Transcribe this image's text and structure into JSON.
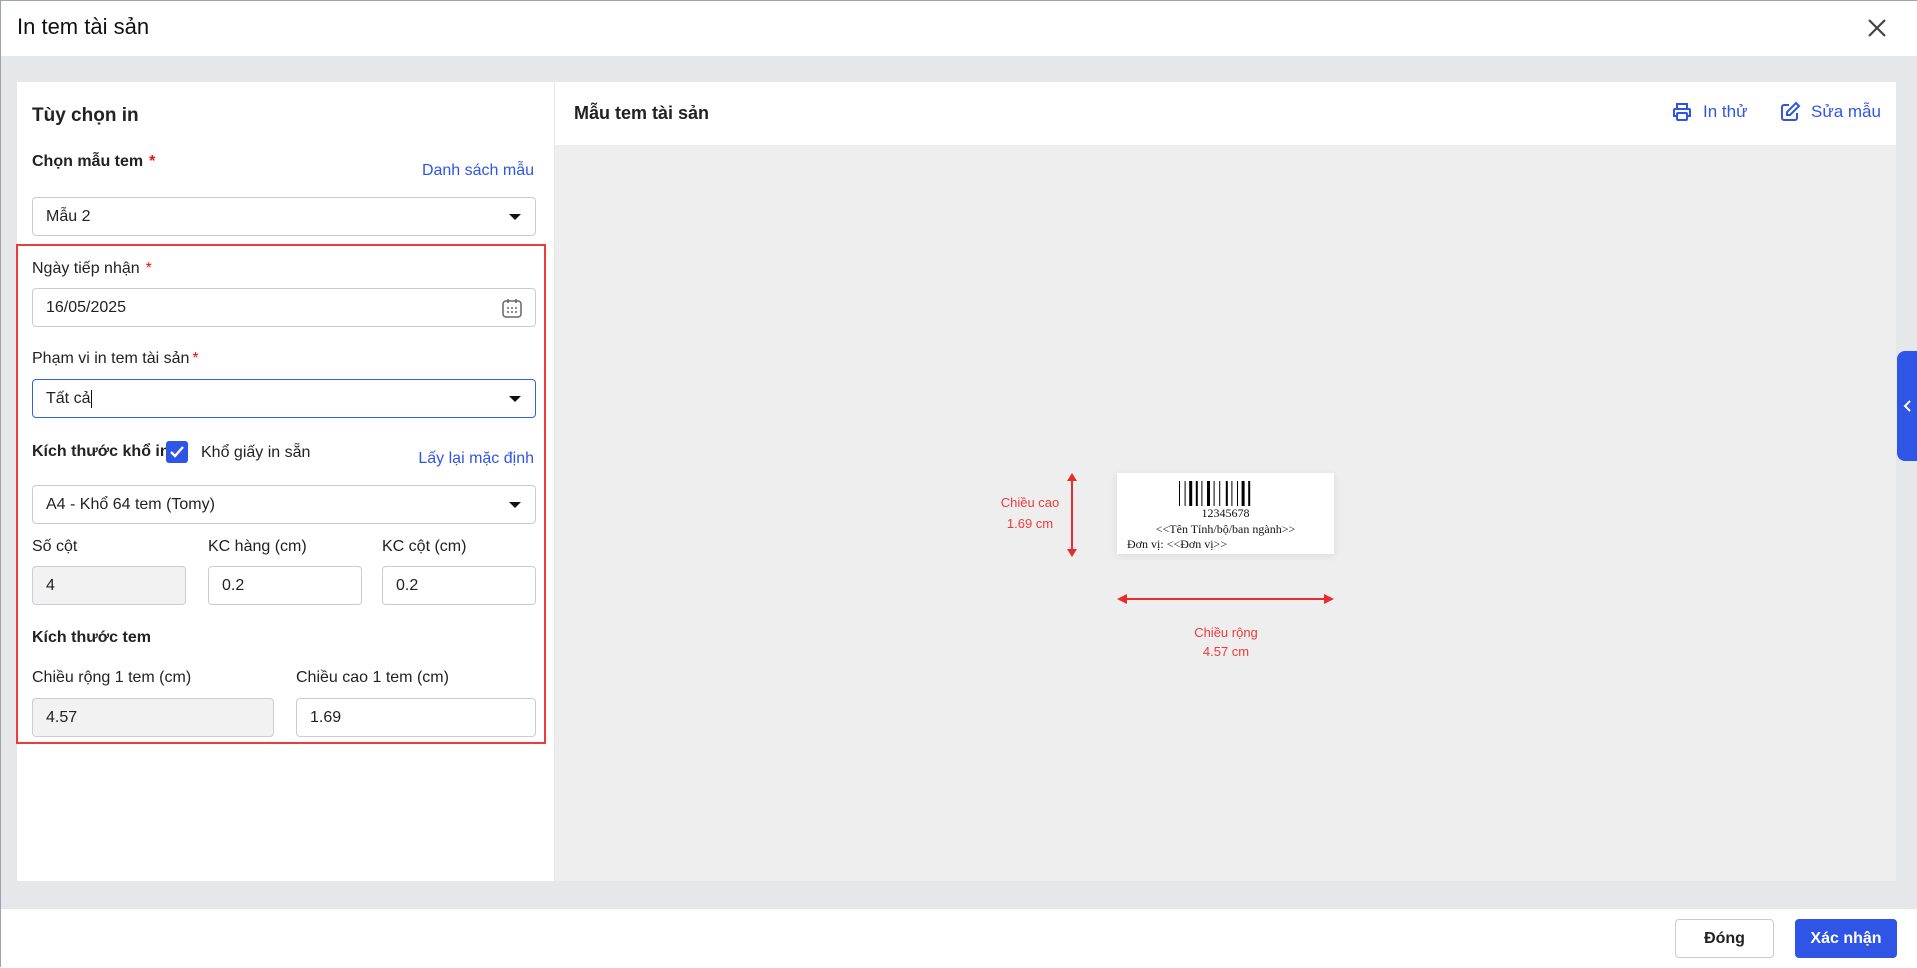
{
  "dialog": {
    "title": "In tem tài sản"
  },
  "left": {
    "heading": "Tùy chọn in",
    "template_label": "Chọn mẫu tem",
    "template_link": "Danh sách mẫu",
    "template_value": "Mẫu 2",
    "date_label": "Ngày tiếp nhận",
    "date_value": "16/05/2025",
    "scope_label": "Phạm vi in tem tài sản",
    "scope_value": "Tất cả",
    "paper_label": "Kích thước khổ in",
    "preset_checkbox_label": "Khổ giấy in sẵn",
    "preset_checked": true,
    "reset_link": "Lấy lại mặc định",
    "paper_value": "A4 - Khổ 64 tem (Tomy)",
    "columns_label": "Số cột",
    "columns_value": "4",
    "row_gap_label": "KC hàng (cm)",
    "row_gap_value": "0.2",
    "col_gap_label": "KC cột (cm)",
    "col_gap_value": "0.2",
    "label_size_heading": "Kích thước tem",
    "width_label": "Chiều rộng 1 tem (cm)",
    "width_value": "4.57",
    "height_label": "Chiều cao 1 tem (cm)",
    "height_value": "1.69",
    "required_mark": "*"
  },
  "right": {
    "heading": "Mẫu tem tài sản",
    "print_test": "In thử",
    "edit_template": "Sửa mẫu",
    "preview": {
      "barcode_number": "12345678",
      "line1": "<<Tên Tỉnh/bộ/ban ngành>>",
      "line2": "Đơn vị: <<Đơn vị>>"
    },
    "height_caption": "Chiều cao",
    "height_value": "1.69 cm",
    "width_caption": "Chiều rộng",
    "width_value": "4.57 cm"
  },
  "footer": {
    "close": "Đóng",
    "confirm": "Xác nhận"
  },
  "colors": {
    "primary": "#2f55e6",
    "highlight": "#ef3a3a"
  }
}
